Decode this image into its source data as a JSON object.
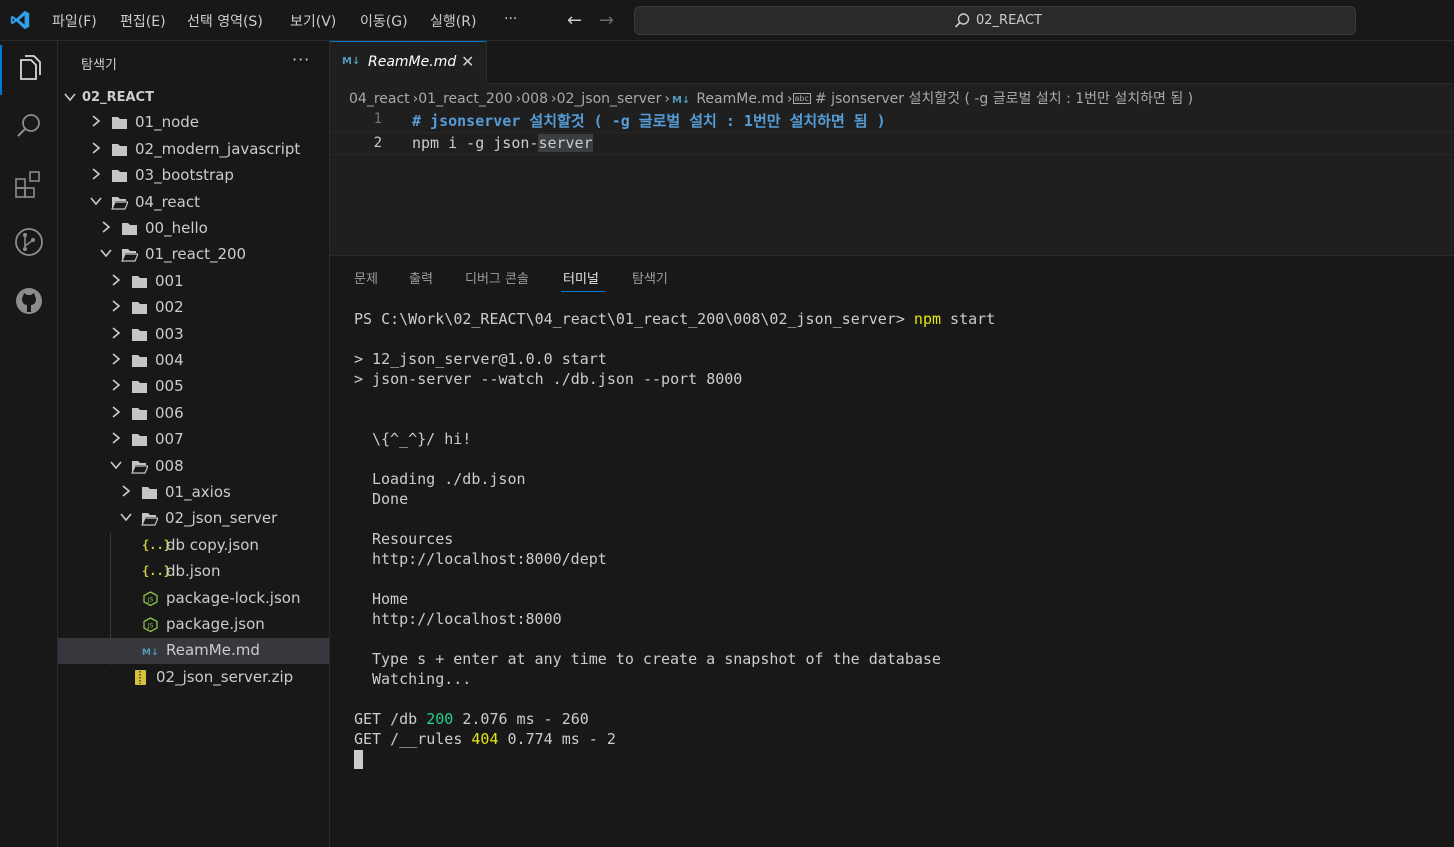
{
  "titlebar": {
    "menu": [
      "파일(F)",
      "편집(E)",
      "선택 영역(S)",
      "보기(V)",
      "이동(G)",
      "실행(R)",
      "···"
    ],
    "nav_back": "←",
    "nav_forward": "→",
    "command_center": "02_REACT"
  },
  "activitybar": {
    "items": [
      "explorer-icon",
      "search-icon",
      "extensions-icon",
      "source-control-icon",
      "github-icon"
    ]
  },
  "sidebar": {
    "title": "탐색기",
    "more": "···",
    "tree": [
      {
        "label": "02_REACT",
        "kind": "root",
        "expanded": true
      },
      {
        "label": "01_node",
        "kind": "folder",
        "expanded": false
      },
      {
        "label": "02_modern_javascript",
        "kind": "folder",
        "expanded": false
      },
      {
        "label": "03_bootstrap",
        "kind": "folder",
        "expanded": false
      },
      {
        "label": "04_react",
        "kind": "folder",
        "expanded": true
      },
      {
        "label": "00_hello",
        "kind": "folder",
        "expanded": false
      },
      {
        "label": "01_react_200",
        "kind": "folder",
        "expanded": true
      },
      {
        "label": "001",
        "kind": "folder",
        "expanded": false
      },
      {
        "label": "002",
        "kind": "folder",
        "expanded": false
      },
      {
        "label": "003",
        "kind": "folder",
        "expanded": false
      },
      {
        "label": "004",
        "kind": "folder",
        "expanded": false
      },
      {
        "label": "005",
        "kind": "folder",
        "expanded": false
      },
      {
        "label": "006",
        "kind": "folder",
        "expanded": false
      },
      {
        "label": "007",
        "kind": "folder",
        "expanded": false
      },
      {
        "label": "008",
        "kind": "folder",
        "expanded": true
      },
      {
        "label": "01_axios",
        "kind": "folder",
        "expanded": false
      },
      {
        "label": "02_json_server",
        "kind": "folder",
        "expanded": true
      },
      {
        "label": "db copy.json",
        "kind": "json"
      },
      {
        "label": "db.json",
        "kind": "json"
      },
      {
        "label": "package-lock.json",
        "kind": "npm"
      },
      {
        "label": "package.json",
        "kind": "npm"
      },
      {
        "label": "ReamMe.md",
        "kind": "md",
        "selected": true
      },
      {
        "label": "02_json_server.zip",
        "kind": "zip"
      }
    ]
  },
  "editor": {
    "tab": {
      "icon": "M↓",
      "label": "ReamMe.md",
      "close": "✕"
    },
    "breadcrumb": [
      "04_react",
      "01_react_200",
      "008",
      "02_json_server",
      "ReamMe.md",
      "# jsonserver 설치할것 ( -g 글로벌 설치 : 1번만 설치하면 됨 )"
    ],
    "breadcrumb_md_icon": "M↓",
    "breadcrumb_abc_icon": "abc",
    "lines": [
      {
        "no": "1",
        "text": "# jsonserver 설치할것 ( -g 글로벌 설치 : 1번만 설치하면 됨 )"
      },
      {
        "no": "2",
        "text_before": "npm i -g json-",
        "text_sel": "server"
      }
    ]
  },
  "panel": {
    "tabs": [
      "문제",
      "출력",
      "디버그 콘솔",
      "터미널",
      "탐색기"
    ],
    "active_tab": "터미널",
    "terminal": {
      "prompt": "PS C:\\Work\\02_REACT\\04_react\\01_react_200\\008\\02_json_server> ",
      "cmd": "npm",
      "cmd_arg": " start",
      "script1": "> 12_json_server@1.0.0 start",
      "script2": "> json-server --watch ./db.json --port 8000",
      "hi": "\\{^_^}/ hi!",
      "loading": "Loading ./db.json",
      "done": "Done",
      "resources_title": "Resources",
      "resources_url": "http://localhost:8000/dept",
      "home_title": "Home",
      "home_url": "http://localhost:8000",
      "tip1": "Type s + enter at any time to create a snapshot of the database",
      "tip2": "Watching...",
      "req1": {
        "method": "GET /db ",
        "status": "200",
        "rest": " 2.076 ms - 260"
      },
      "req2": {
        "method": "GET /__rules ",
        "status": "404",
        "rest": " 0.774 ms - 2"
      }
    }
  },
  "colors": {
    "accent": "#0078d4",
    "heading": "#569cd6",
    "status_ok": "#23d18b",
    "status_warn": "#e5e510",
    "terminal_cyan": "#29b8db"
  }
}
